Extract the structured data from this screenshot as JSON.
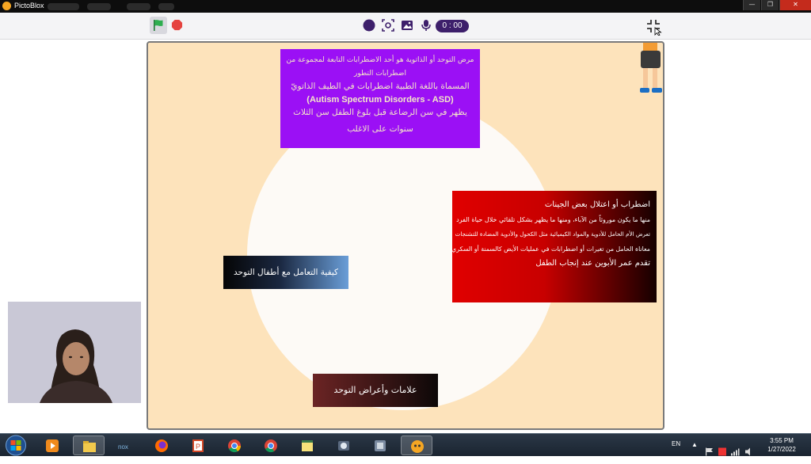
{
  "window": {
    "title": "PictoBlox",
    "controls": {
      "minimize": "—",
      "maximize": "❐",
      "close": "✕"
    }
  },
  "toolbar": {
    "icons": [
      "green-flag-icon",
      "stop-icon",
      "record-icon",
      "screenshot-icon",
      "image-icon",
      "microphone-icon",
      "fullscreen-exit-icon"
    ],
    "timer": "0 : 00",
    "colors": {
      "flag": "#2eae4f",
      "stop": "#e5433f",
      "purple": "#3d1f6b"
    }
  },
  "stage": {
    "background": "#fde3bb",
    "definition_box": {
      "lines": [
        "مرض التوحد أو الذاتوية هو أحد الاضطرابات التابعة لمجموعة من اضطرابات التطور",
        "المسماة باللغة الطبية اضطرابات في الطيف الذاتويّ",
        "(Autism Spectrum Disorders - ASD)",
        "يظهر في سن الرضاعة قبل بلوغ الطفل سن الثلاث",
        "سنوات على الاغلب"
      ]
    },
    "causes_box": {
      "lines": [
        "اضطراب أو اعتلال بعض الجينات",
        "منها ما يكون موروثاً من الآباء، ومنها ما يظهر بشكل تلقائي خلال حياة الفرد",
        "تعرض الأم الحامل للأدوية والمواد الكيميائية مثل الكحول والأدوية المضادة للتشنجات",
        "معاناة الحامل من تغيرات أو اضطرابات في عمليات الأيض كالسمنة أو السكري",
        "تقدم عمر الأبوين عند إنجاب الطفل"
      ]
    },
    "buttons": {
      "dealing_with_autistic_children": "كيفية التعامل مع أطفال التوحد",
      "autism_signs_symptoms": "علامات وأعراض التوحد"
    }
  },
  "taskbar": {
    "apps": [
      "start-button",
      "media-player-icon",
      "file-explorer-icon",
      "nox-icon",
      "firefox-icon",
      "powerpoint-icon",
      "chrome-icon",
      "chrome-beta-icon",
      "sticky-notes-icon",
      "app-icon-8",
      "app-icon-9",
      "pictoblox-icon"
    ],
    "language": "EN",
    "time": "3:55 PM",
    "date": "1/27/2022"
  }
}
